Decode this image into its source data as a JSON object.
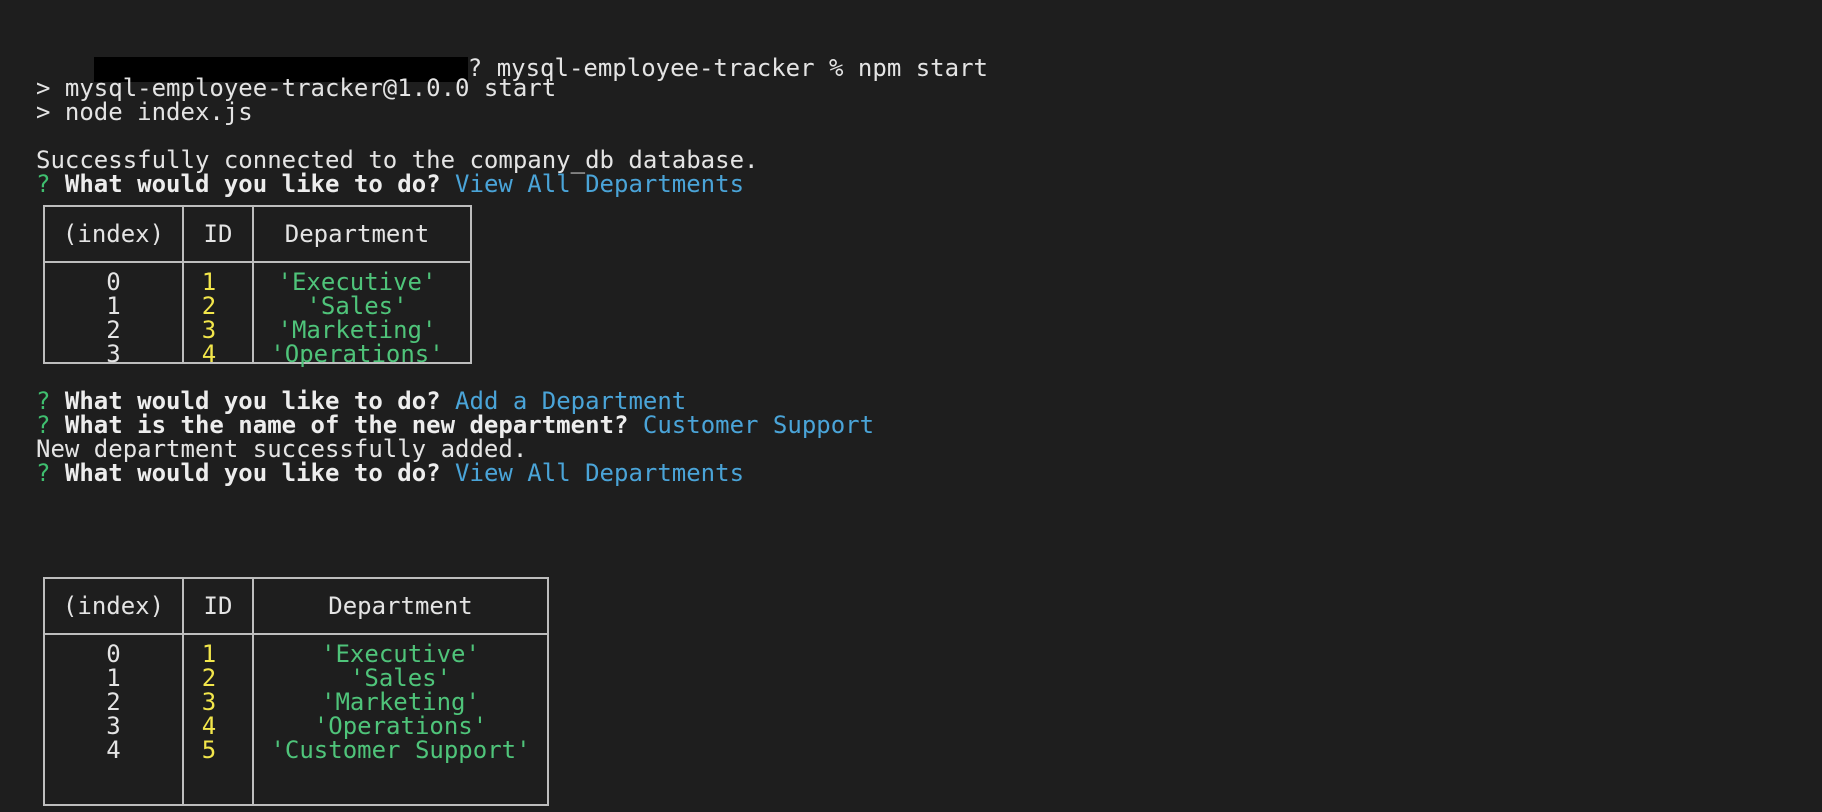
{
  "terminal": {
    "prompt": {
      "path_suffix": "? mysql-employee-tracker % npm start"
    },
    "npm_lines": [
      "> mysql-employee-tracker@1.0.0 start",
      "> node index.js"
    ],
    "connected_msg": "Successfully connected to the company_db database.",
    "qmark": "?",
    "prompts": [
      {
        "question": "What would you like to do?",
        "answer": "View All Departments"
      },
      {
        "question": "What would you like to do?",
        "answer": "Add a Department"
      },
      {
        "question": "What is the name of the new department?",
        "answer": "Customer Support"
      },
      {
        "question": "What would you like to do?",
        "answer": "View All Departments"
      }
    ],
    "added_msg": "New department successfully added.",
    "tables": [
      {
        "headers": [
          "(index)",
          "ID",
          "Department"
        ],
        "rows": [
          [
            "0",
            "1",
            "'Executive'"
          ],
          [
            "1",
            "2",
            "'Sales'"
          ],
          [
            "2",
            "3",
            "'Marketing'"
          ],
          [
            "3",
            "4",
            "'Operations'"
          ]
        ]
      },
      {
        "headers": [
          "(index)",
          "ID",
          "Department"
        ],
        "rows": [
          [
            "0",
            "1",
            "'Executive'"
          ],
          [
            "1",
            "2",
            "'Sales'"
          ],
          [
            "2",
            "3",
            "'Marketing'"
          ],
          [
            "3",
            "4",
            "'Operations'"
          ],
          [
            "4",
            "5",
            "'Customer Support'"
          ]
        ]
      }
    ],
    "colors": {
      "background": "#1e1e1e",
      "prompt_qmark": "#3fbf6f",
      "answer": "#4aa4d8",
      "number": "#f2e64b",
      "string": "#4fc47a",
      "border": "#bdbdbd"
    }
  }
}
